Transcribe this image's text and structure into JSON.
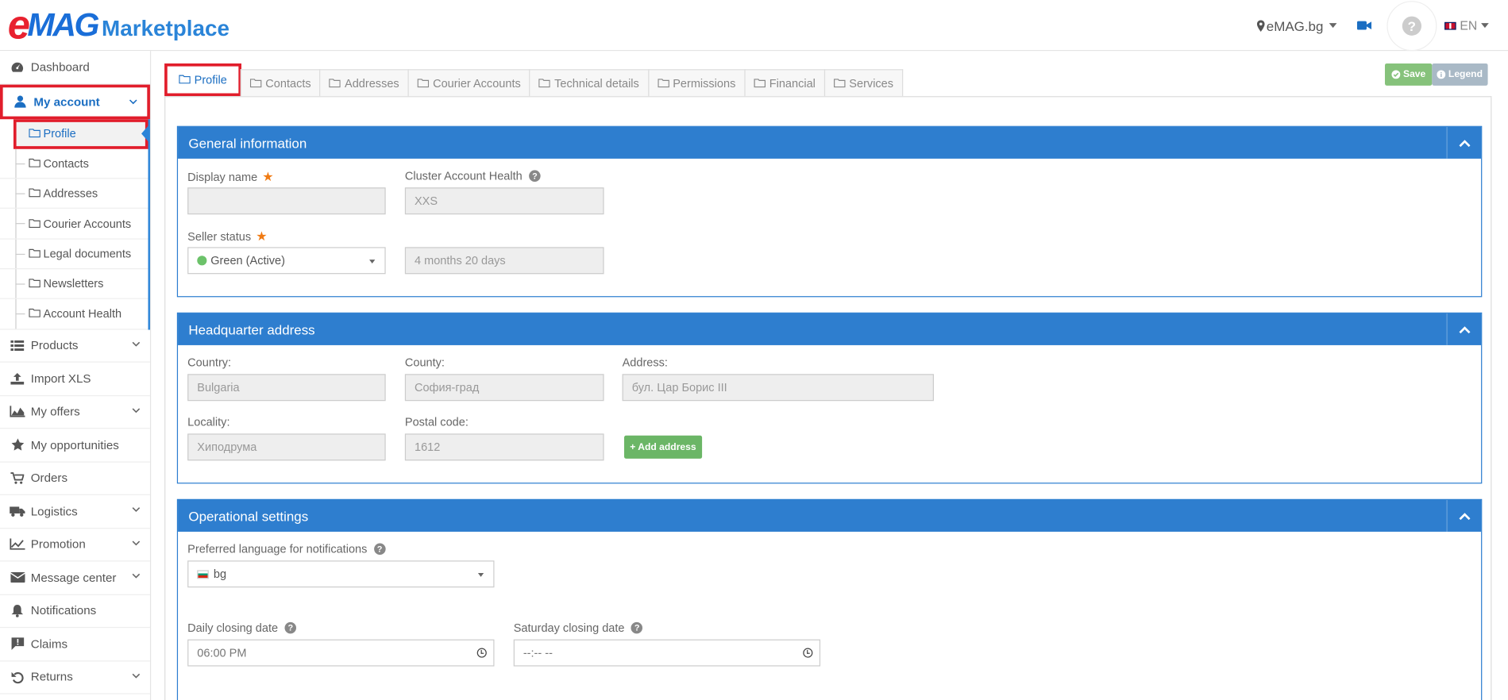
{
  "brand": {
    "e": "e",
    "mag": "MAG",
    "marketplace": "Marketplace",
    "e_color": "#e8212f",
    "mag_color": "#1a6ed8",
    "marketplace_color": "#2a84d8"
  },
  "topbar": {
    "site": "eMAG.bg",
    "language": "EN"
  },
  "sidebar": {
    "items": [
      {
        "label": "Dashboard",
        "icon": "dashboard-icon"
      },
      {
        "label": "My account",
        "icon": "user-icon"
      },
      {
        "label": "Products",
        "icon": "list-icon"
      },
      {
        "label": "Import XLS",
        "icon": "upload-icon"
      },
      {
        "label": "My offers",
        "icon": "area-chart-icon"
      },
      {
        "label": "My opportunities",
        "icon": "star-icon"
      },
      {
        "label": "Orders",
        "icon": "cart-icon"
      },
      {
        "label": "Logistics",
        "icon": "truck-icon"
      },
      {
        "label": "Promotion",
        "icon": "line-chart-icon"
      },
      {
        "label": "Message center",
        "icon": "envelope-icon"
      },
      {
        "label": "Notifications",
        "icon": "bell-icon"
      },
      {
        "label": "Claims",
        "icon": "comment-exclamation-icon"
      },
      {
        "label": "Returns",
        "icon": "undo-icon"
      }
    ],
    "subitems": [
      "Profile",
      "Contacts",
      "Addresses",
      "Courier Accounts",
      "Legal documents",
      "Newsletters",
      "Account Health"
    ]
  },
  "tabs": [
    "Profile",
    "Contacts",
    "Addresses",
    "Courier Accounts",
    "Technical details",
    "Permissions",
    "Financial",
    "Services"
  ],
  "actions": {
    "save": "Save",
    "legend": "Legend"
  },
  "general": {
    "title": "General information",
    "display_name_label": "Display name",
    "display_name_value": "",
    "cluster_label": "Cluster Account Health",
    "cluster_value": "XXS",
    "seller_status_label": "Seller status",
    "seller_status_value": "Green (Active)",
    "duration_value": "4 months 20 days"
  },
  "headquarter": {
    "title": "Headquarter address",
    "country_label": "Country:",
    "country_value": "Bulgaria",
    "county_label": "County:",
    "county_value": "София-град",
    "address_label": "Address:",
    "address_value": "бул. Цар Борис III",
    "locality_label": "Locality:",
    "locality_value": "Хиподрума",
    "postal_label": "Postal code:",
    "postal_value": "1612",
    "add_address": "+ Add address"
  },
  "operational": {
    "title": "Operational settings",
    "lang_label": "Preferred language for notifications",
    "lang_value": "bg",
    "daily_label": "Daily closing date",
    "daily_value": "06:00 PM",
    "saturday_label": "Saturday closing date",
    "saturday_value": "--:-- --"
  }
}
